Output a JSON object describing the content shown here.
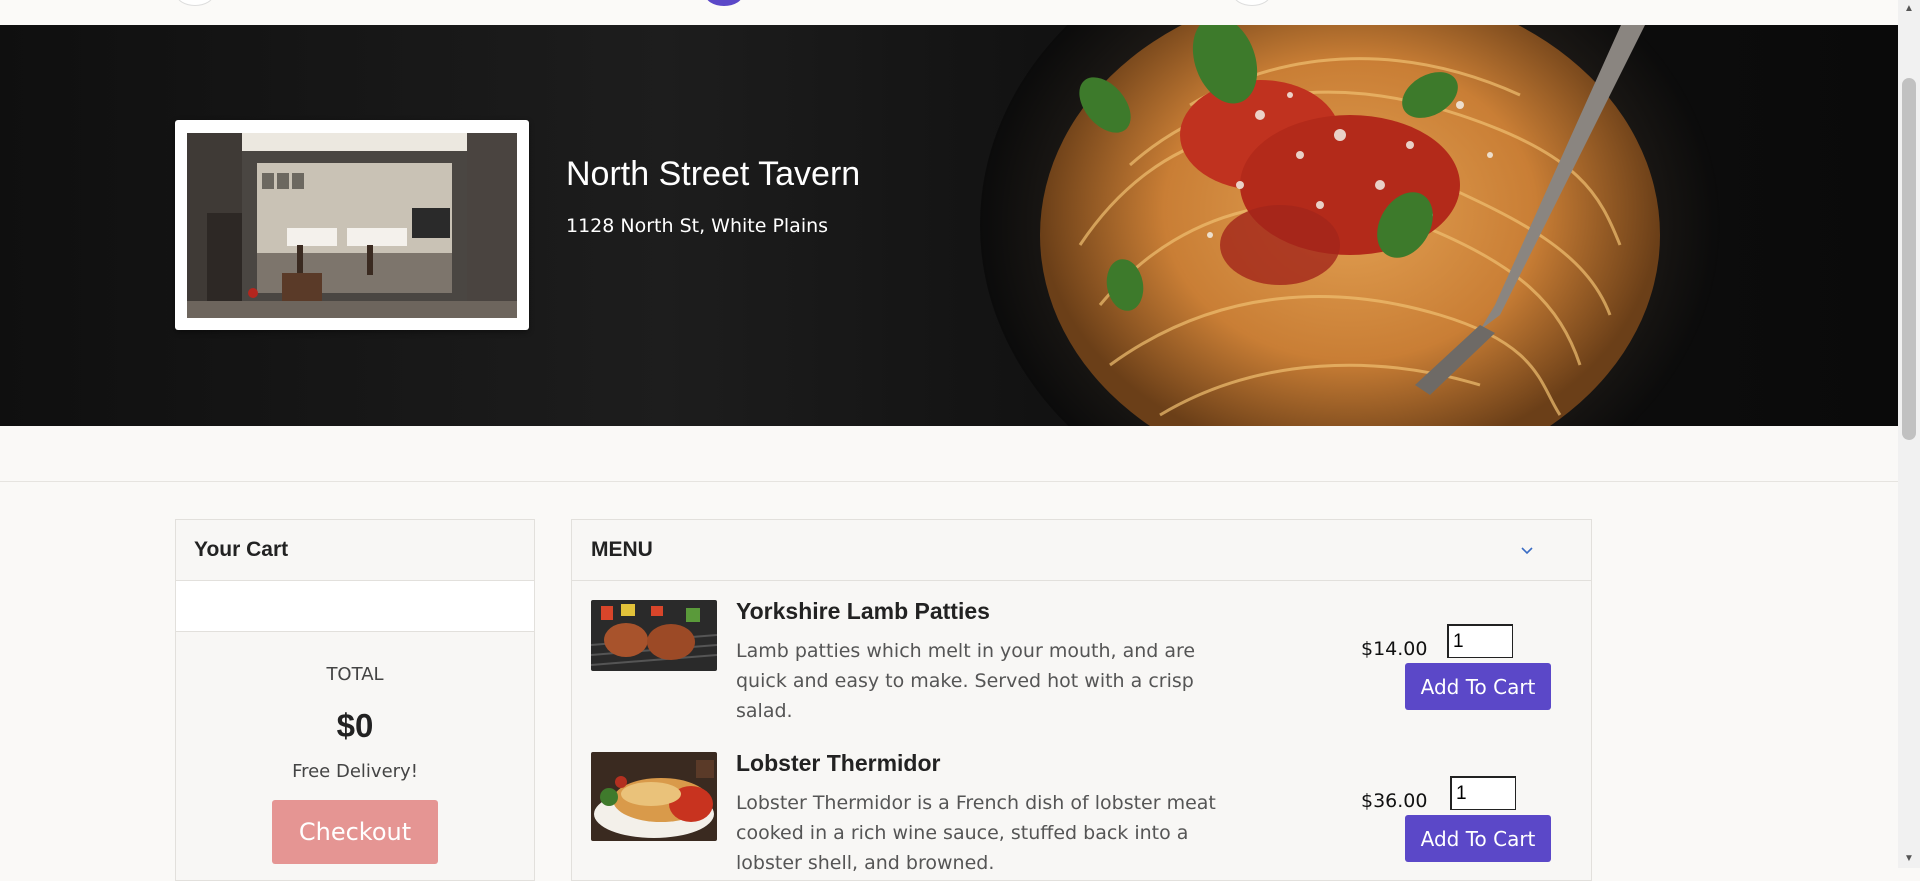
{
  "restaurant": {
    "name": "North Street Tavern",
    "address": "1128 North St, White Plains"
  },
  "cart": {
    "title": "Your Cart",
    "total_label": "TOTAL",
    "total_value": "$0",
    "delivery_note": "Free Delivery!",
    "checkout_label": "Checkout"
  },
  "menu": {
    "title": "MENU",
    "items": [
      {
        "name": "Yorkshire Lamb Patties",
        "description": "Lamb patties which melt in your mouth, and are quick and easy to make. Served hot with a crisp salad.",
        "price": "$14.00",
        "quantity": "1",
        "button_label": "Add To Cart"
      },
      {
        "name": "Lobster Thermidor",
        "description": "Lobster Thermidor is a French dish of lobster meat cooked in a rich wine sauce, stuffed back into a lobster shell, and browned.",
        "price": "$36.00",
        "quantity": "1",
        "button_label": "Add To Cart"
      }
    ]
  },
  "colors": {
    "accent": "#5b48c8",
    "checkout": "#e59593",
    "hero_bg": "#121212",
    "page_bg": "#faf9f7"
  },
  "icons": {
    "menu_toggle": "chevron-down-icon",
    "scroll_up": "triangle-up-icon",
    "scroll_down": "triangle-down-icon"
  }
}
